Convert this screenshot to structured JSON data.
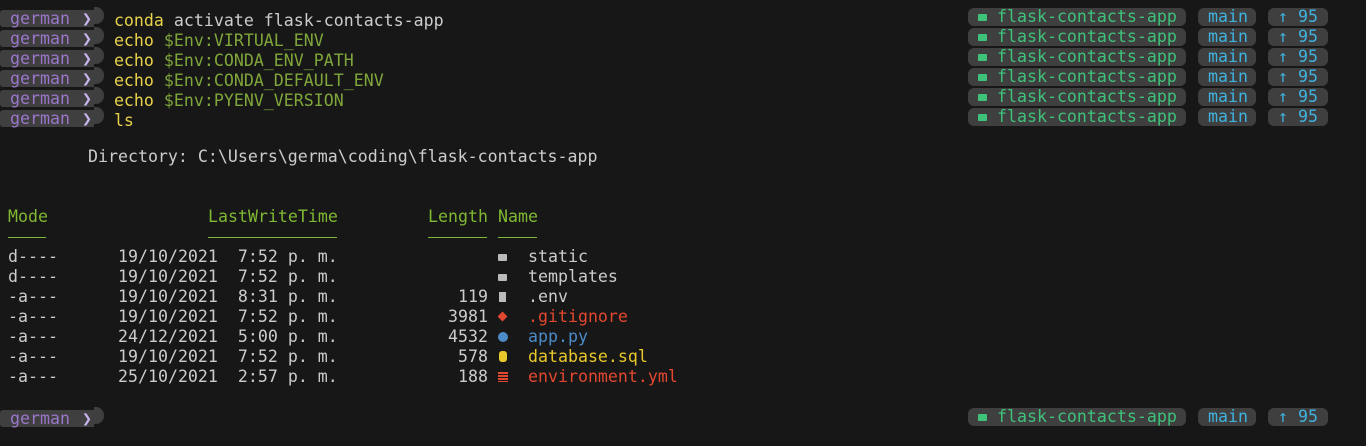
{
  "prompt": {
    "user": "german",
    "arrow": "❯"
  },
  "right_prompt": {
    "folder": "flask-contacts-app",
    "branch": "main",
    "ahead": "↑ 95"
  },
  "commands": [
    {
      "cmd": "conda",
      "rest": " activate flask-contacts-app",
      "var": ""
    },
    {
      "cmd": "echo",
      "rest": " ",
      "var": "$Env:VIRTUAL_ENV"
    },
    {
      "cmd": "echo",
      "rest": " ",
      "var": "$Env:CONDA_ENV_PATH"
    },
    {
      "cmd": "echo",
      "rest": " ",
      "var": "$Env:CONDA_DEFAULT_ENV"
    },
    {
      "cmd": "echo",
      "rest": " ",
      "var": "$Env:PYENV_VERSION"
    },
    {
      "cmd": "ls",
      "rest": "",
      "var": ""
    }
  ],
  "listing": {
    "directory_line": "Directory: C:\\Users\\germa\\coding\\flask-contacts-app",
    "headers": {
      "mode": "Mode",
      "lastwrite": "LastWriteTime",
      "length": "Length",
      "name": "Name"
    },
    "rows": [
      {
        "mode": "d----",
        "date": "19/10/2021",
        "time": "7:52 p. m.",
        "length": "",
        "name": "static",
        "icon": "folder-icon",
        "color": "#cccccc"
      },
      {
        "mode": "d----",
        "date": "19/10/2021",
        "time": "7:52 p. m.",
        "length": "",
        "name": "templates",
        "icon": "folder-icon",
        "color": "#cccccc"
      },
      {
        "mode": "-a---",
        "date": "19/10/2021",
        "time": "8:31 p. m.",
        "length": "119",
        "name": ".env",
        "icon": "file-icon",
        "color": "#cccccc"
      },
      {
        "mode": "-a---",
        "date": "19/10/2021",
        "time": "7:52 p. m.",
        "length": "3981",
        "name": ".gitignore",
        "icon": "git-icon",
        "color": "#e2482f"
      },
      {
        "mode": "-a---",
        "date": "24/12/2021",
        "time": "5:00 p. m.",
        "length": "4532",
        "name": "app.py",
        "icon": "python-icon",
        "color": "#4b8bc7"
      },
      {
        "mode": "-a---",
        "date": "19/10/2021",
        "time": "7:52 p. m.",
        "length": "578",
        "name": "database.sql",
        "icon": "database-icon",
        "color": "#e8c82a"
      },
      {
        "mode": "-a---",
        "date": "25/10/2021",
        "time": "2:57 p. m.",
        "length": "188",
        "name": "environment.yml",
        "icon": "yaml-icon",
        "color": "#e2482f"
      }
    ]
  }
}
